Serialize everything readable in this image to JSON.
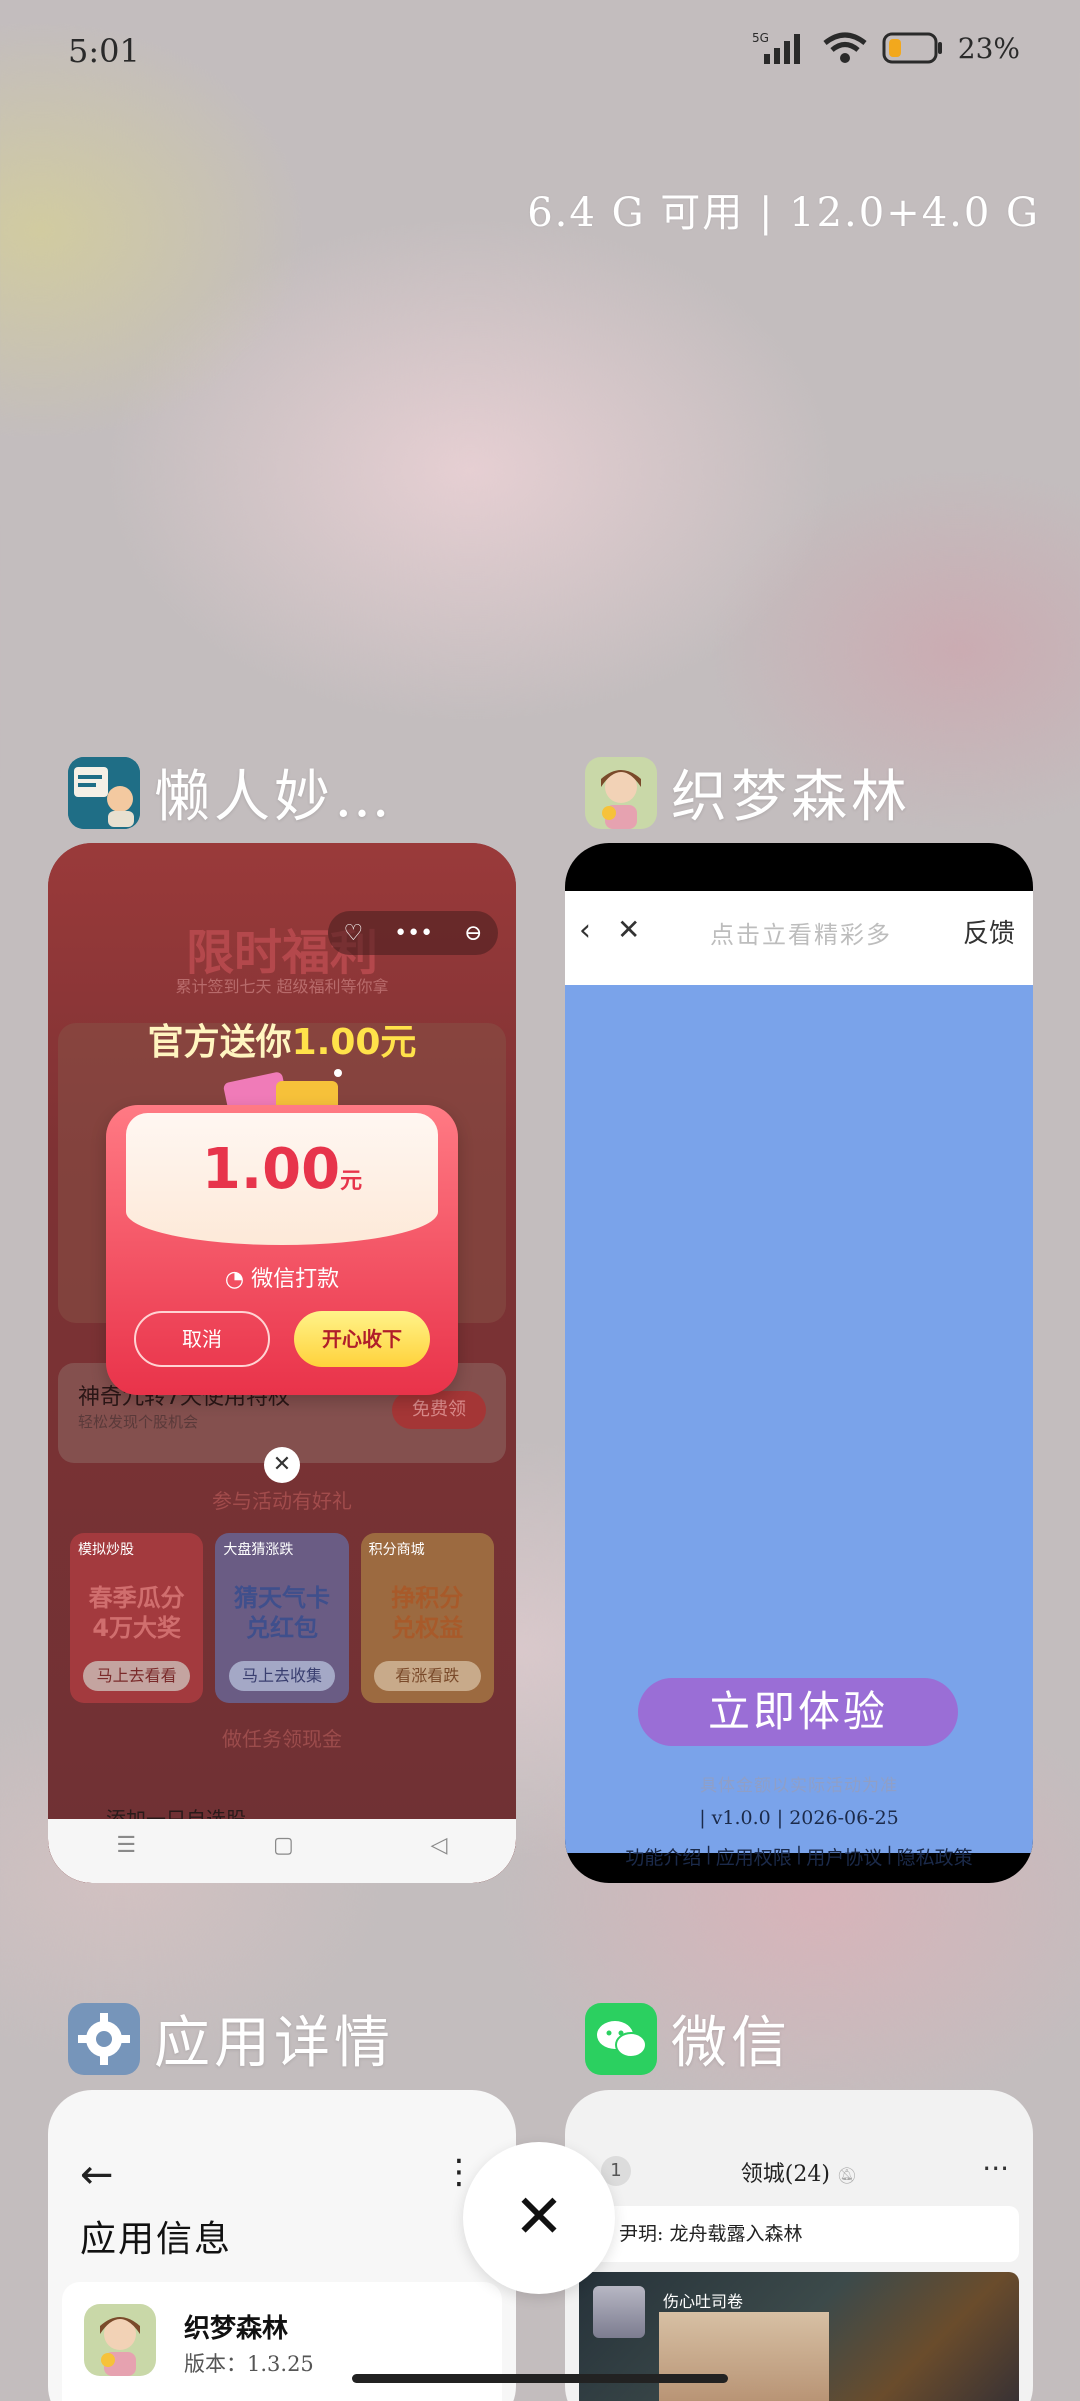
{
  "status": {
    "time": "5:01",
    "network": "5G",
    "battery": "23%"
  },
  "memory": "6.4 G 可用 | 12.0+4.0 G",
  "apps": [
    {
      "name": "懒人妙…",
      "icon": "lanren-app-icon",
      "screen": {
        "title": "限时福利",
        "subtitle": "累计签到七天 超级福利等你拿",
        "dialog_title_prefix": "官方送你",
        "dialog_title_amount": "1.00元",
        "amount": "1.00",
        "unit": "元",
        "payment_label": "微信打款",
        "cancel_label": "取消",
        "accept_label": "开心收下",
        "task_title": "神奇九转7天使用特权",
        "task_subtitle": "轻松发现个股机会",
        "task_button": "免费领",
        "section_label": "参与活动有好礼",
        "promos": [
          {
            "tag": "模拟炒股",
            "big": "春季瓜分\n4万大奖",
            "button": "马上去看看"
          },
          {
            "tag": "大盘猜涨跌",
            "big": "猜天气卡\n兑红包",
            "button": "马上去收集"
          },
          {
            "tag": "积分商城",
            "big": "挣积分\n兑权益",
            "button": "看涨看跌"
          }
        ],
        "more_label": "做任务领现金",
        "bottom_text": "添加一只自选股"
      }
    },
    {
      "name": "织梦森林",
      "icon": "zhimeng-app-icon",
      "screen": {
        "hint": "点击立看精彩多",
        "feedback": "反馈",
        "cta": "立即体验",
        "fine_print": "具体金额以实际活动为准",
        "version_line": "| v1.0.0 | 2026-06-25",
        "links": [
          "功能介绍",
          "|",
          "应用权限",
          "|",
          "用户协议",
          "|",
          "隐私政策"
        ]
      }
    },
    {
      "name": "应用详情",
      "icon": "settings-app-icon",
      "screen": {
        "title": "应用信息",
        "app_name": "织梦森林",
        "app_version": "版本：1.3.25"
      }
    },
    {
      "name": "微信",
      "icon": "wechat-app-icon",
      "screen": {
        "badge": "1",
        "chat_title": "领城(24)",
        "notice": "尹玥: 龙舟载露入森林",
        "sender": "伤心吐司卷"
      }
    }
  ],
  "colors": {
    "lanren_bg": "#7e3234",
    "zhimeng_bg": "#7aa3ea",
    "zhimeng_cta": "#9a6ed6",
    "wechat_green": "#2bd060",
    "settings_blue": "#6f8fb4"
  }
}
